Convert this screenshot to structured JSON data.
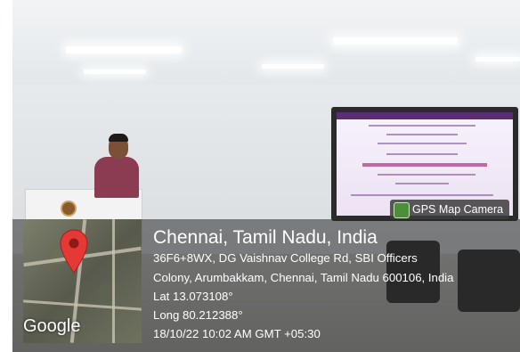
{
  "gps_badge": {
    "label": "GPS Map Camera",
    "icon": "gps-map-camera-icon"
  },
  "map": {
    "watermark": "Google",
    "pin_icon": "location-pin-icon",
    "pin_color": "#e53935"
  },
  "location": {
    "title": "Chennai, Tamil Nadu, India",
    "address_line1": "36F6+8WX, DG Vaishnav College Rd, SBI Officers",
    "address_line2": "Colony, Arumbakkam, Chennai, Tamil Nadu 600106, India",
    "lat": "Lat 13.073108°",
    "long": "Long 80.212388°",
    "datetime": "18/10/22 10:02 AM GMT +05:30"
  }
}
